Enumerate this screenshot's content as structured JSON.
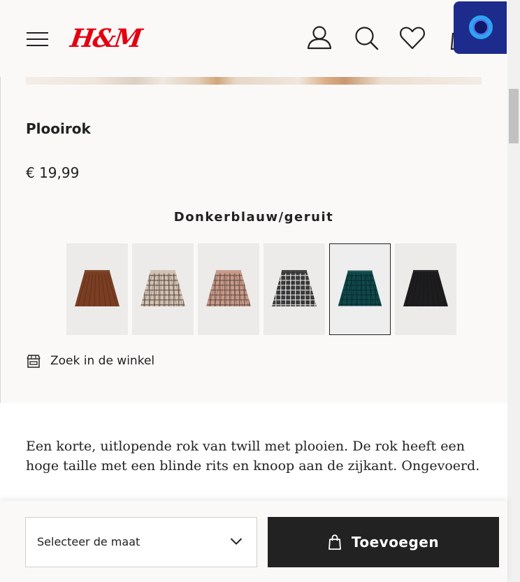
{
  "header": {
    "logo": "H&M",
    "icons": [
      "menu-icon",
      "account-icon",
      "search-icon",
      "favorites-icon",
      "bag-icon"
    ],
    "brand_color": "#e50010"
  },
  "product": {
    "title": "Plooirok",
    "price": "€ 19,99",
    "selected_color": "Donkerblauw/geruit",
    "swatches": [
      {
        "name": "bruin",
        "color": "#7a3e22",
        "pattern": "solid"
      },
      {
        "name": "beige geruit",
        "color": "#cfc2b3",
        "pattern": "check"
      },
      {
        "name": "roze geruit",
        "color": "#c79a8a",
        "pattern": "check"
      },
      {
        "name": "zwart/wit geruit",
        "color": "#3a3a3a",
        "pattern": "check"
      },
      {
        "name": "donkerblauw/geruit",
        "color": "#0f4a48",
        "pattern": "tartan",
        "selected": true
      },
      {
        "name": "zwart",
        "color": "#1d1d1f",
        "pattern": "solid"
      }
    ],
    "store_link": "Zoek in de winkel",
    "description": "Een korte, uitlopende rok van twill met plooien. De rok heeft een hoge taille met een blinde rits en knoop aan de zijkant. Ongevoerd."
  },
  "actions": {
    "size_select": "Selecteer de maat",
    "add_button": "Toevoegen"
  }
}
